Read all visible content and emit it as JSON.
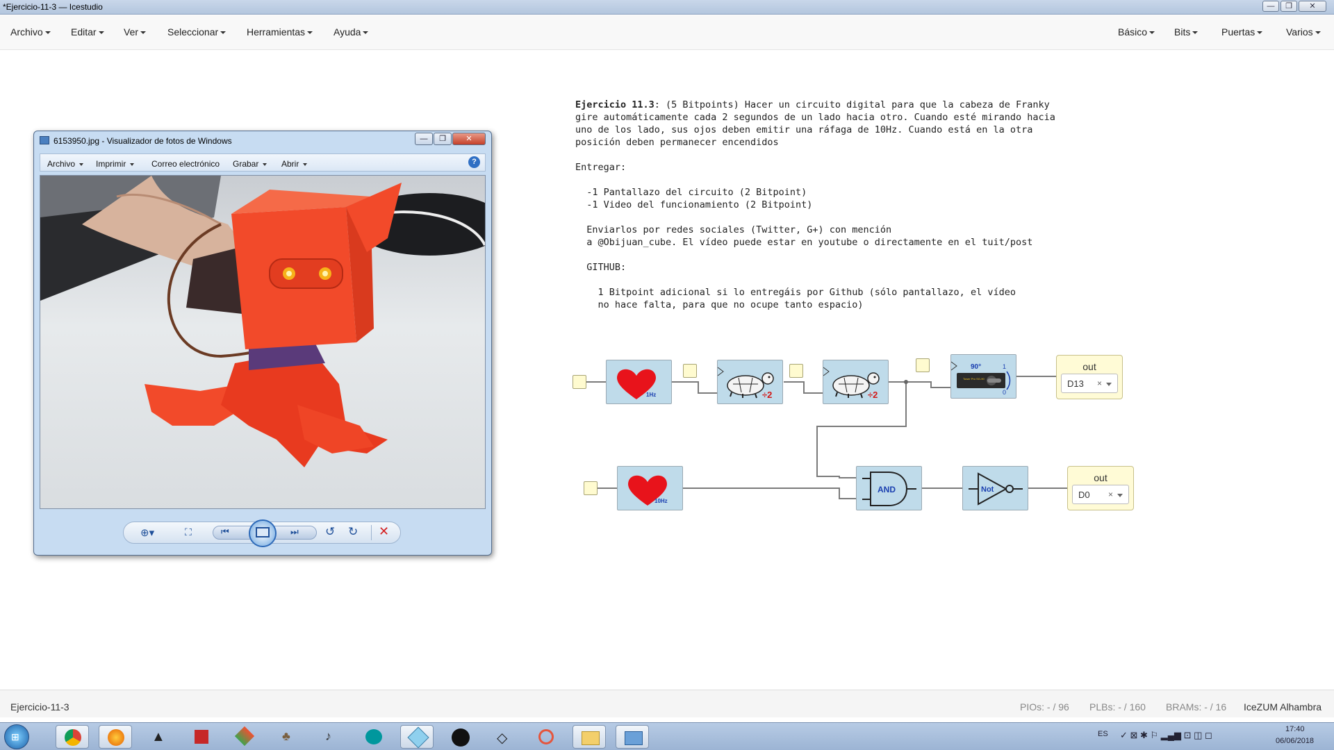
{
  "window": {
    "title": "*Ejercicio-11-3 — Icestudio",
    "minimize": "—",
    "maximize": "❐",
    "close": "✕"
  },
  "menubar": {
    "left": [
      "Archivo",
      "Editar",
      "Ver",
      "Seleccionar",
      "Herramientas",
      "Ayuda"
    ],
    "right": [
      "Básico",
      "Bits",
      "Puertas",
      "Varios"
    ]
  },
  "info": {
    "title_bold": "Ejercicio 11.3",
    "title_rest": ": (5 Bitpoints) Hacer un circuito digital para que la cabeza de Franky",
    "lines": [
      "gire automáticamente cada 2 segundos de un lado hacia otro. Cuando esté mirando hacia",
      "uno de los lado, sus ojos deben emitir una ráfaga de 10Hz. Cuando está en la otra",
      "posición deben permanecer encendidos",
      "",
      "Entregar:",
      "",
      "  -1 Pantallazo del circuito (2 Bitpoint)",
      "  -1 Video del funcionamiento (2 Bitpoint)",
      "",
      "  Enviarlos por redes sociales (Twitter, G+) con mención",
      "  a @Obijuan_cube. El vídeo puede estar en youtube o directamente en el tuit/post",
      "",
      "  GITHUB:",
      "",
      "    1 Bitpoint adicional si lo entregáis por Github (sólo pantallazo, el vídeo",
      "    no hace falta, para que no ocupe tanto espacio)"
    ]
  },
  "circuit": {
    "heart1_label": "1Hz",
    "heart2_label": "10Hz",
    "div_label": "÷2",
    "servo_angle": "90°",
    "servo_one": "1",
    "servo_zero": "0",
    "servo_text": "Tower Pro SG-90",
    "and_label": "AND",
    "not_label": "Not",
    "out1": {
      "label": "out",
      "value": "D13",
      "clear": "×"
    },
    "out2": {
      "label": "out",
      "value": "D0",
      "clear": "×"
    }
  },
  "photo_viewer": {
    "title": "6153950.jpg - Visualizador de fotos de Windows",
    "menus": [
      "Archivo",
      "Imprimir",
      "Correo electrónico",
      "Grabar",
      "Abrir"
    ],
    "help": "?"
  },
  "statusbar": {
    "project": "Ejercicio-11-3",
    "pios": "PIOs: - / 96",
    "plbs": "PLBs: - / 160",
    "brams": "BRAMs: - / 16",
    "board": "IceZUM Alhambra"
  },
  "taskbar": {
    "lang": "ES",
    "time": "17:40",
    "date": "06/06/2018"
  },
  "colors": {
    "block": "#bfdbea",
    "port": "#fffbd0",
    "heart": "#e8131b",
    "robot": "#f24a2a",
    "wire": "#777777"
  }
}
